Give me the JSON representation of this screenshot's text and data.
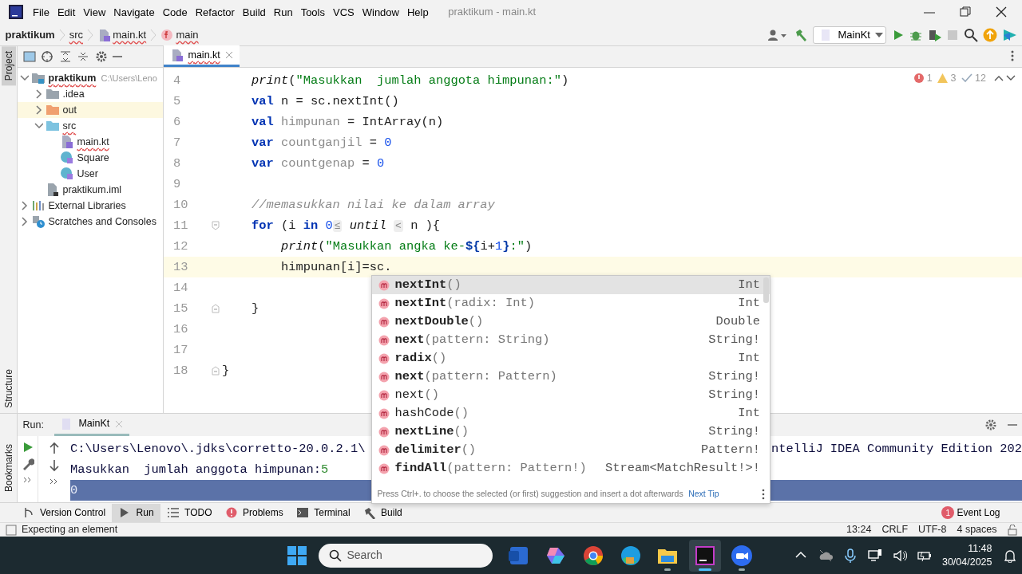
{
  "title_bar": {
    "menu": [
      "File",
      "Edit",
      "View",
      "Navigate",
      "Code",
      "Refactor",
      "Build",
      "Run",
      "Tools",
      "VCS",
      "Window",
      "Help"
    ],
    "title": "praktikum - main.kt"
  },
  "breadcrumb": [
    {
      "label": "praktikum",
      "kind": "project",
      "error": false
    },
    {
      "label": "src",
      "kind": "folder",
      "error": true
    },
    {
      "label": "main.kt",
      "kind": "kotlin-file",
      "error": true
    },
    {
      "label": "main",
      "kind": "function",
      "error": true
    }
  ],
  "run_config": {
    "label": "MainKt"
  },
  "side_stripe": {
    "top": "Project",
    "bottom": "Structure",
    "run": "Bookmarks"
  },
  "project_tree": [
    {
      "label": "praktikum",
      "path": "C:\\Users\\Leno",
      "kind": "module",
      "expanded": true,
      "highlighted": false,
      "error": true,
      "children": [
        {
          "label": ".idea",
          "kind": "folder",
          "expanded": false,
          "highlighted": false,
          "error": false
        },
        {
          "label": "out",
          "kind": "excluded-folder",
          "expanded": false,
          "highlighted": true,
          "error": false
        },
        {
          "label": "src",
          "kind": "source-folder",
          "expanded": true,
          "highlighted": false,
          "error": true,
          "children": [
            {
              "label": "main.kt",
              "kind": "kotlin-file",
              "highlighted": false,
              "error": true
            },
            {
              "label": "Square",
              "kind": "kotlin-class",
              "highlighted": false,
              "error": false
            },
            {
              "label": "User",
              "kind": "kotlin-class",
              "highlighted": false,
              "error": false
            }
          ]
        },
        {
          "label": "praktikum.iml",
          "kind": "iml",
          "highlighted": false,
          "error": false
        }
      ]
    },
    {
      "label": "External Libraries",
      "kind": "libraries",
      "expanded": false,
      "highlighted": false,
      "error": false
    },
    {
      "label": "Scratches and Consoles",
      "kind": "scratches",
      "expanded": false,
      "highlighted": false,
      "error": false
    }
  ],
  "editor": {
    "tab": {
      "label": "main.kt",
      "selected": true
    },
    "inspections": {
      "errors": "1",
      "warnings": "3",
      "weak": "12"
    },
    "lines": [
      {
        "number": "4",
        "current": false,
        "tokens": [
          {
            "kind": "fn",
            "text": "    print"
          },
          {
            "kind": "plain",
            "text": "("
          },
          {
            "kind": "str",
            "text": "\"Masukkan  jumlah anggota himpunan:\""
          },
          {
            "kind": "plain",
            "text": ")"
          }
        ]
      },
      {
        "number": "5",
        "current": false,
        "tokens": [
          {
            "kind": "kw",
            "text": "    val"
          },
          {
            "kind": "plain",
            "text": " n = sc.nextInt()"
          }
        ]
      },
      {
        "number": "6",
        "current": false,
        "tokens": [
          {
            "kind": "kw",
            "text": "    val "
          },
          {
            "kind": "unused",
            "text": "himpunan"
          },
          {
            "kind": "plain",
            "text": " = IntArray(n)"
          }
        ]
      },
      {
        "number": "7",
        "current": false,
        "tokens": [
          {
            "kind": "kw",
            "text": "    var "
          },
          {
            "kind": "unused",
            "text": "countganjil"
          },
          {
            "kind": "plain",
            "text": " = "
          },
          {
            "kind": "num",
            "text": "0"
          }
        ]
      },
      {
        "number": "8",
        "current": false,
        "tokens": [
          {
            "kind": "kw",
            "text": "    var "
          },
          {
            "kind": "unused",
            "text": "countgenap"
          },
          {
            "kind": "plain",
            "text": " = "
          },
          {
            "kind": "num",
            "text": "0"
          }
        ]
      },
      {
        "number": "9",
        "current": false
      },
      {
        "number": "10",
        "current": false,
        "tokens": [
          {
            "kind": "comment",
            "text": "    //memasukkan nilai ke dalam array"
          }
        ]
      },
      {
        "number": "11",
        "current": false,
        "kind": "fold-start",
        "tokens": [
          {
            "kind": "kw",
            "text": "    for"
          },
          {
            "kind": "plain",
            "text": " (i "
          },
          {
            "kind": "kw",
            "text": "in "
          },
          {
            "kind": "num",
            "text": "0"
          },
          {
            "kind": "hint",
            "text": "≤"
          },
          {
            "kind": "fn",
            "text": " until "
          },
          {
            "kind": "hint",
            "text": "<"
          },
          {
            "kind": "plain",
            "text": " n ){"
          }
        ]
      },
      {
        "number": "12",
        "current": false,
        "tokens": [
          {
            "kind": "fn",
            "text": "        print"
          },
          {
            "kind": "plain",
            "text": "("
          },
          {
            "kind": "str",
            "text": "\"Masukkan angka ke-"
          },
          {
            "kind": "tmpl",
            "text": "${"
          },
          {
            "kind": "plain",
            "text": "i+"
          },
          {
            "kind": "num",
            "text": "1"
          },
          {
            "kind": "tmpl",
            "text": "}"
          },
          {
            "kind": "str",
            "text": ":\""
          },
          {
            "kind": "plain",
            "text": ")"
          }
        ]
      },
      {
        "number": "13",
        "current": true,
        "tokens": [
          {
            "kind": "plain",
            "text": "        himpunan[i]=sc."
          }
        ]
      },
      {
        "number": "14",
        "current": false
      },
      {
        "number": "15",
        "current": false,
        "kind": "fold-end",
        "tokens": [
          {
            "kind": "plain",
            "text": "    }"
          }
        ]
      },
      {
        "number": "16",
        "current": false
      },
      {
        "number": "17",
        "current": false
      },
      {
        "number": "18",
        "current": false,
        "kind": "fold-end",
        "tokens": [
          {
            "kind": "plain",
            "text": "}"
          }
        ]
      }
    ]
  },
  "completion": {
    "items": [
      {
        "name": "nextInt",
        "params": "()",
        "type": "Int",
        "bold": true,
        "selected": true
      },
      {
        "name": "nextInt",
        "params": "(radix: Int)",
        "type": "Int",
        "bold": true,
        "selected": false
      },
      {
        "name": "nextDouble",
        "params": "()",
        "type": "Double",
        "bold": true,
        "selected": false
      },
      {
        "name": "next",
        "params": "(pattern: String)",
        "type": "String!",
        "bold": true,
        "selected": false
      },
      {
        "name": "radix",
        "params": "()",
        "type": "Int",
        "bold": true,
        "selected": false
      },
      {
        "name": "next",
        "params": "(pattern: Pattern)",
        "type": "String!",
        "bold": true,
        "selected": false
      },
      {
        "name": "next",
        "params": "()",
        "type": "String!",
        "bold": false,
        "selected": false
      },
      {
        "name": "hashCode",
        "params": "()",
        "type": "Int",
        "bold": false,
        "selected": false
      },
      {
        "name": "nextLine",
        "params": "()",
        "type": "String!",
        "bold": true,
        "selected": false
      },
      {
        "name": "delimiter",
        "params": "()",
        "type": "Pattern!",
        "bold": true,
        "selected": false
      },
      {
        "name": "findAll",
        "params": "(pattern: Pattern!)",
        "type": "Stream<MatchResult!>!",
        "bold": true,
        "selected": false
      }
    ],
    "hint": "Press Ctrl+. to choose the selected (or first) suggestion and insert a dot afterwards",
    "link": "Next Tip"
  },
  "run": {
    "label": "Run:",
    "tab": "MainKt",
    "console": [
      {
        "text": "C:\\Users\\Lenovo\\.jdks\\corretto-20.0.2.1\\",
        "tail": "ntelliJ IDEA Community Edition 202",
        "selected": false
      },
      {
        "text": "Masukkan  jumlah anggota himpunan:",
        "input": "5",
        "selected": false
      },
      {
        "text": "0",
        "selected": true
      }
    ]
  },
  "tool_windows": [
    {
      "label": "Version Control",
      "kind": "vcs",
      "selected": false
    },
    {
      "label": "Run",
      "kind": "run",
      "selected": true
    },
    {
      "label": "TODO",
      "kind": "todo",
      "selected": false
    },
    {
      "label": "Problems",
      "kind": "problems",
      "selected": false
    },
    {
      "label": "Terminal",
      "kind": "terminal",
      "selected": false
    },
    {
      "label": "Build",
      "kind": "build",
      "selected": false
    }
  ],
  "event_log": {
    "label": "Event Log",
    "count": "1"
  },
  "status_bar": {
    "message": "Expecting an element",
    "items": [
      "13:24",
      "CRLF",
      "UTF-8",
      "4 spaces"
    ]
  },
  "taskbar": {
    "search_placeholder": "Search",
    "apps": [
      {
        "kind": "word",
        "running": false,
        "selected": false
      },
      {
        "kind": "copilot",
        "running": false,
        "selected": false
      },
      {
        "kind": "chrome",
        "running": false,
        "selected": false
      },
      {
        "kind": "edge",
        "running": false,
        "selected": false
      },
      {
        "kind": "explorer",
        "running": true,
        "selected": false
      },
      {
        "kind": "intellij",
        "running": true,
        "selected": true
      },
      {
        "kind": "zoom",
        "running": true,
        "selected": false
      }
    ],
    "time": "11:48",
    "date": "30/04/2025"
  }
}
